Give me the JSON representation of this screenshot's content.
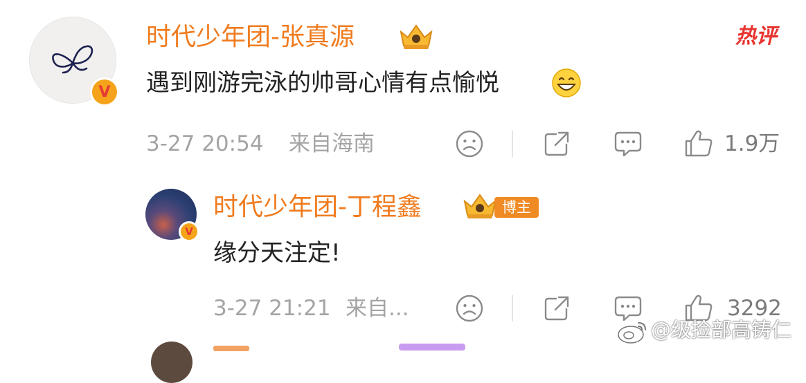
{
  "comments": [
    {
      "username": "时代少年团-张真源",
      "text": "遇到刚游完泳的帅哥心情有点愉悦",
      "time": "3-27 20:54",
      "location": "来自海南",
      "like_count": "1.9万",
      "hot_label": "热评",
      "badge": "V"
    },
    {
      "username": "时代少年团-丁程鑫",
      "text": "缘分天注定!",
      "time": "3-27 21:21",
      "location": "来自...",
      "like_count": "3292",
      "author_label": "博主",
      "badge": "V"
    }
  ],
  "watermark": "@级捡部高铸仁",
  "icons": [
    "emoji-grin-icon",
    "sad-face-icon",
    "share-icon",
    "comment-icon",
    "thumb-up-icon",
    "crown-icon",
    "weibo-logo-icon"
  ],
  "colors": {
    "username": "#f07b1e",
    "hot": "#e8342f",
    "meta": "#a4a4a4",
    "badge": "#f5a31a",
    "author_tag": "#f08a24"
  }
}
